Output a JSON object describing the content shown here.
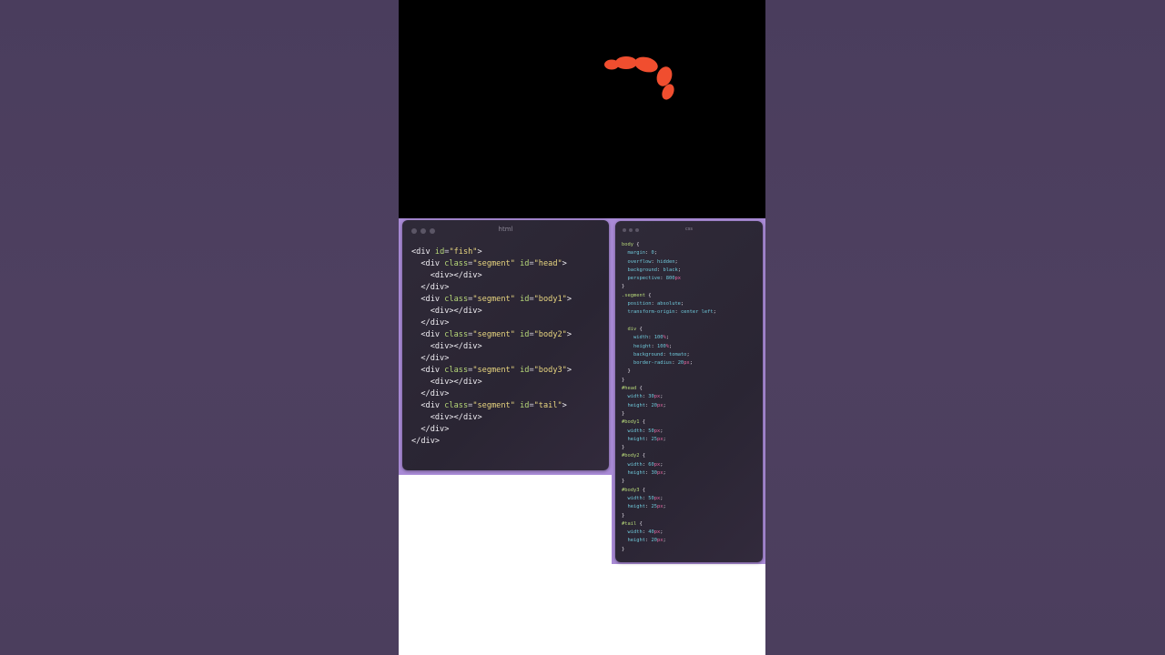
{
  "colors": {
    "background": "#4d3f5f",
    "stage": "#000000",
    "fish": "#f04e2f",
    "accent_band": "#a98ad6",
    "editor_bg": "#2c2735"
  },
  "stage": {
    "object": "fish"
  },
  "html_window": {
    "title": "html",
    "lines": [
      "<div id=\"fish\">",
      "  <div class=\"segment\" id=\"head\">",
      "    <div></div>",
      "  </div>",
      "  <div class=\"segment\" id=\"body1\">",
      "    <div></div>",
      "  </div>",
      "  <div class=\"segment\" id=\"body2\">",
      "    <div></div>",
      "  </div>",
      "  <div class=\"segment\" id=\"body3\">",
      "    <div></div>",
      "  </div>",
      "  <div class=\"segment\" id=\"tail\">",
      "    <div></div>",
      "  </div>",
      "</div>"
    ]
  },
  "css_window": {
    "title": "css",
    "lines": [
      "body {",
      "  margin: 0;",
      "  overflow: hidden;",
      "  background: black;",
      "  perspective: 800px",
      "}",
      ".segment {",
      "  position: absolute;",
      "  transform-origin: center left;",
      "",
      "  div {",
      "    width: 100%;",
      "    height: 100%;",
      "    background: tomato;",
      "    border-radius: 20px;",
      "  }",
      "}",
      "#head {",
      "  width: 30px;",
      "  height: 20px;",
      "}",
      "#body1 {",
      "  width: 50px;",
      "  height: 25px;",
      "}",
      "#body2 {",
      "  width: 60px;",
      "  height: 30px;",
      "}",
      "#body3 {",
      "  width: 50px;",
      "  height: 25px;",
      "}",
      "#tail {",
      "  width: 40px;",
      "  height: 20px;",
      "}"
    ]
  }
}
